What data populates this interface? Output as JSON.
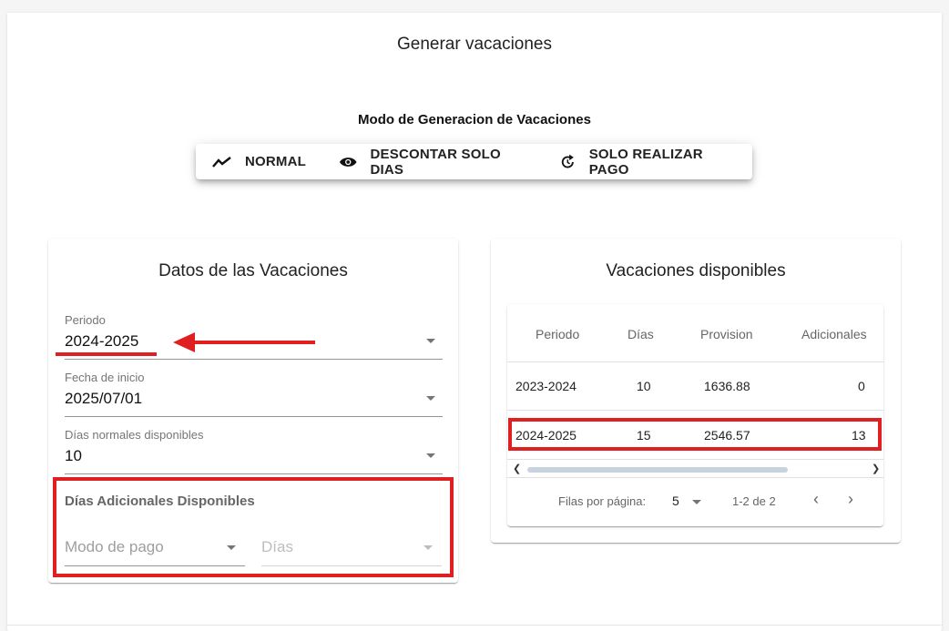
{
  "page": {
    "title": "Generar vacaciones"
  },
  "mode": {
    "heading": "Modo de Generacion de Vacaciones",
    "options": [
      {
        "label": "NORMAL",
        "icon": "trending-icon"
      },
      {
        "label": "DESCONTAR SOLO DIAS",
        "icon": "eye-icon"
      },
      {
        "label": "SOLO REALIZAR PAGO",
        "icon": "refresh-icon"
      }
    ]
  },
  "datos": {
    "title": "Datos de las Vacaciones",
    "periodo": {
      "label": "Periodo",
      "value": "2024-2025"
    },
    "fecha_inicio": {
      "label": "Fecha de inicio",
      "value": "2025/07/01"
    },
    "dias_normales": {
      "label": "Días normales disponibles",
      "value": "10"
    },
    "adicionales": {
      "title": "Días Adicionales Disponibles",
      "modo_pago_placeholder": "Modo de pago",
      "dias_placeholder": "Días"
    }
  },
  "disponibles": {
    "title": "Vacaciones disponibles",
    "columns": [
      "Periodo",
      "Días",
      "Provision",
      "Adicionales"
    ],
    "rows": [
      [
        "2023-2024",
        "10",
        "1636.88",
        "0"
      ],
      [
        "2024-2025",
        "15",
        "2546.57",
        "13"
      ]
    ],
    "footer": {
      "rows_per_page_label": "Filas por página:",
      "rows_per_page_value": "5",
      "range": "1-2 de 2"
    }
  },
  "annotations": {
    "highlight_color": "#e02020"
  }
}
